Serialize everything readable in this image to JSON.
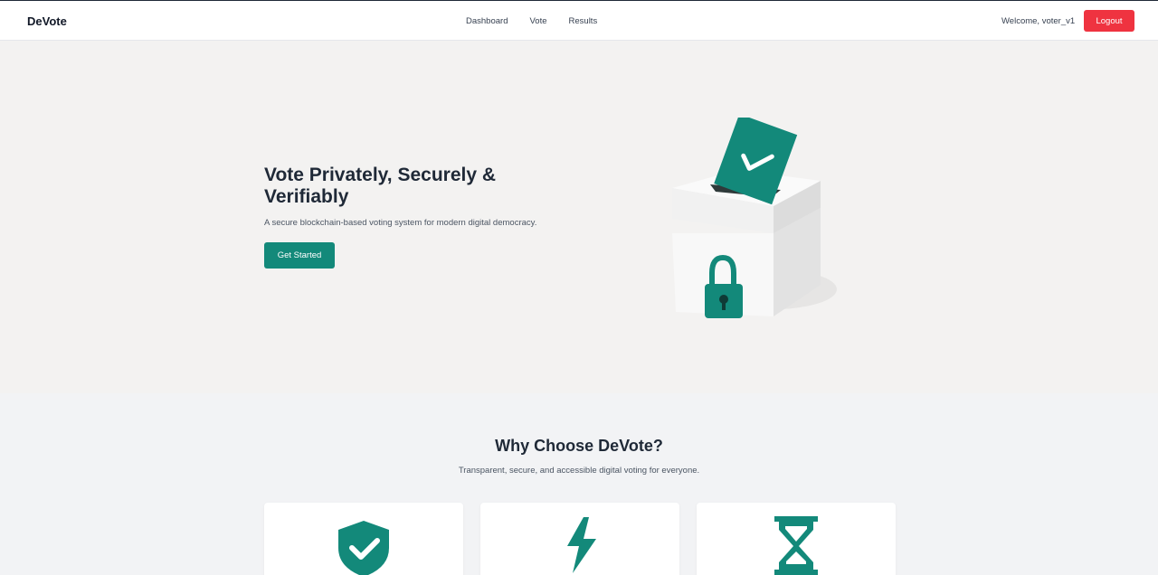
{
  "nav": {
    "brand": "DeVote",
    "links": [
      "Dashboard",
      "Vote",
      "Results"
    ],
    "welcome": "Welcome, voter_v1",
    "logout_label": "Logout"
  },
  "hero": {
    "title": "Vote Privately, Securely & Verifiably",
    "subtitle": "A secure blockchain-based voting system for modern digital democracy.",
    "cta_label": "Get Started"
  },
  "features": {
    "title": "Why Choose DeVote?",
    "subtitle": "Transparent, secure, and accessible digital voting for everyone.",
    "cards": [
      {
        "icon": "shield-check-icon"
      },
      {
        "icon": "lightning-icon"
      },
      {
        "icon": "hourglass-icon"
      }
    ]
  },
  "colors": {
    "accent": "#13897a",
    "danger": "#ef3340",
    "text_dark": "#1f2937"
  }
}
